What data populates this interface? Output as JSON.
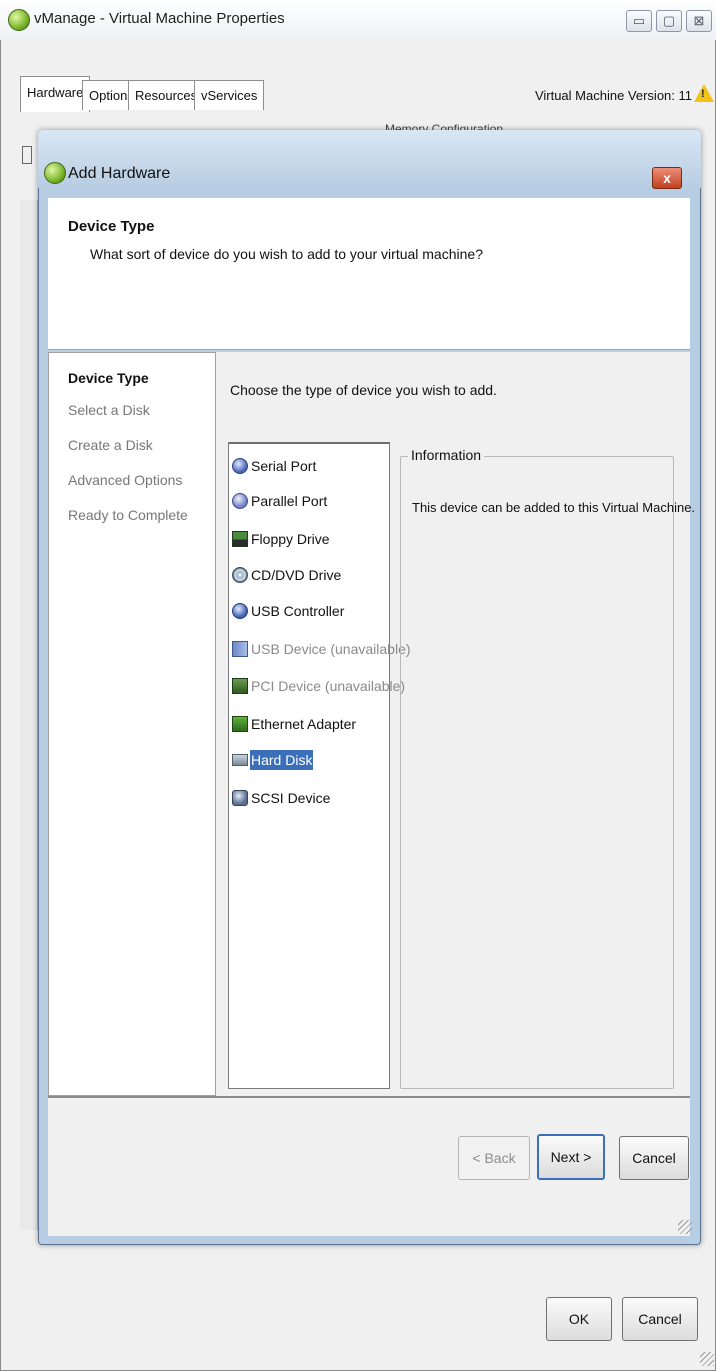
{
  "window": {
    "title": "vManage - Virtual Machine Properties",
    "icon": "vmanage-app-icon",
    "controls": {
      "minimize": "▭",
      "maximize": "▢",
      "close": "⊠"
    }
  },
  "tabs": [
    {
      "label": "Hardware",
      "active": true
    },
    {
      "label": "Options",
      "active": false
    },
    {
      "label": "Resources",
      "active": false
    },
    {
      "label": "vServices",
      "active": false
    }
  ],
  "vm_version": "Virtual Machine Version: 11",
  "background_label": "Memory Configuration",
  "dialog": {
    "title": "Add Hardware",
    "close": "x",
    "header_title": "Device Type",
    "header_subtitle": "What sort of device do you wish to add to your virtual machine?",
    "steps": [
      {
        "label": "Device Type",
        "current": true
      },
      {
        "label": "Select a Disk",
        "current": false
      },
      {
        "label": "Create a Disk",
        "current": false
      },
      {
        "label": "Advanced Options",
        "current": false
      },
      {
        "label": "Ready to Complete",
        "current": false
      }
    ],
    "instruction": "Choose the type of device you wish to add.",
    "devices": [
      {
        "label": "Serial Port",
        "icon": "serial-port-icon",
        "state": "available"
      },
      {
        "label": "Parallel Port",
        "icon": "parallel-port-icon",
        "state": "available"
      },
      {
        "label": "Floppy Drive",
        "icon": "floppy-drive-icon",
        "state": "available"
      },
      {
        "label": "CD/DVD Drive",
        "icon": "cd-dvd-icon",
        "state": "available"
      },
      {
        "label": "USB Controller",
        "icon": "usb-controller-icon",
        "state": "available"
      },
      {
        "label": "USB Device (unavailable)",
        "icon": "usb-device-icon",
        "state": "unavailable"
      },
      {
        "label": "PCI Device (unavailable)",
        "icon": "pci-device-icon",
        "state": "unavailable"
      },
      {
        "label": "Ethernet Adapter",
        "icon": "ethernet-adapter-icon",
        "state": "available"
      },
      {
        "label": "Hard Disk",
        "icon": "hard-disk-icon",
        "state": "selected"
      },
      {
        "label": "SCSI Device",
        "icon": "scsi-device-icon",
        "state": "available"
      }
    ],
    "info_legend": "Information",
    "info_text": "This device can be added to this Virtual Machine.",
    "buttons": {
      "back": "< Back",
      "next": "Next >",
      "cancel": "Cancel"
    }
  },
  "outer_buttons": {
    "ok": "OK",
    "cancel": "Cancel"
  },
  "colors": {
    "selection": "#3b6fb8",
    "dialog_frame": "#b7cde3",
    "warning": "#f0c21a"
  }
}
